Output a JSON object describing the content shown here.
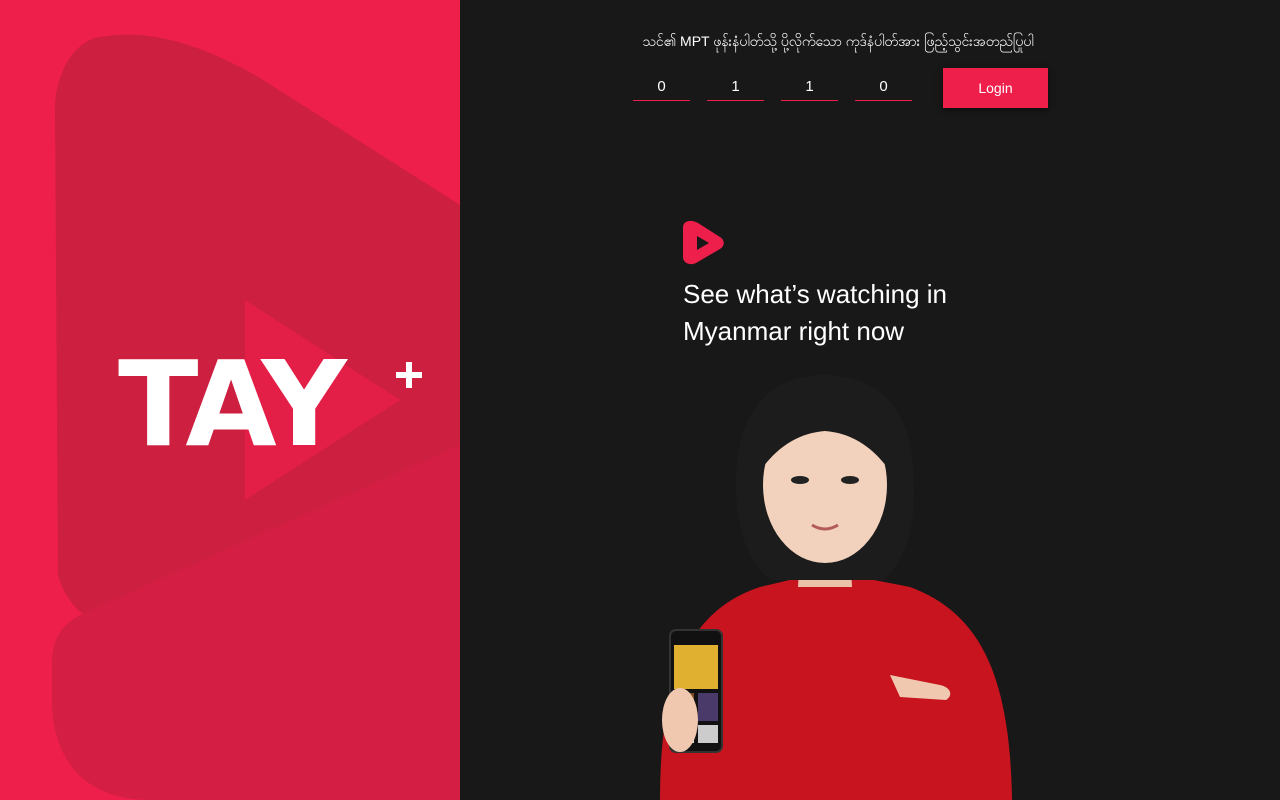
{
  "brand": {
    "logo_text": "TAY",
    "logo_plus": "+",
    "primary_color": "#ee1f4b",
    "background_color": "#181818"
  },
  "login": {
    "instruction": "သင်၏ MPT ဖုန်းနံပါတ်သို့ ပို့လိုက်သော ကုဒ်နံပါတ်အား ဖြည့်သွင်းအတည်ပြုပါ",
    "digits": [
      "0",
      "1",
      "1",
      "0"
    ],
    "button_label": "Login"
  },
  "hero": {
    "line1": "See what’s watching in",
    "line2": "Myanmar right now",
    "logo_icon": "play-logo-icon",
    "image": "woman-holding-phone"
  }
}
